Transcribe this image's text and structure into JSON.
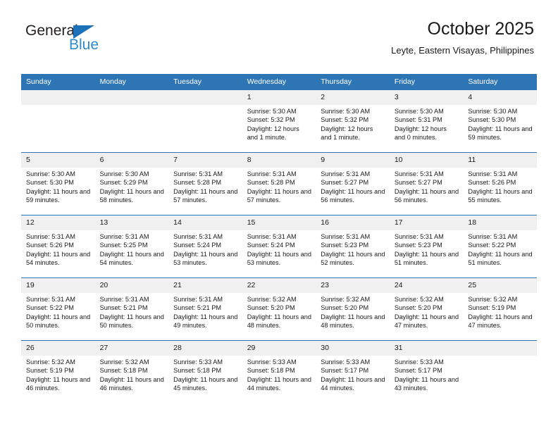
{
  "brand": {
    "name_top": "General",
    "name_bottom": "Blue",
    "flag_icon": "triangle-flag-icon",
    "colors": {
      "blue": "#1d71b8",
      "light_blue": "#2d8bce",
      "header_blue": "#2e75b6"
    }
  },
  "header": {
    "title": "October 2025",
    "subtitle": "Leyte, Eastern Visayas, Philippines"
  },
  "calendar": {
    "weekday_headers": [
      "Sunday",
      "Monday",
      "Tuesday",
      "Wednesday",
      "Thursday",
      "Friday",
      "Saturday"
    ],
    "weeks": [
      [
        {
          "day": "",
          "empty": true
        },
        {
          "day": "",
          "empty": true
        },
        {
          "day": "",
          "empty": true
        },
        {
          "day": "1",
          "sunrise": "Sunrise: 5:30 AM",
          "sunset": "Sunset: 5:32 PM",
          "daylight": "Daylight: 12 hours and 1 minute."
        },
        {
          "day": "2",
          "sunrise": "Sunrise: 5:30 AM",
          "sunset": "Sunset: 5:32 PM",
          "daylight": "Daylight: 12 hours and 1 minute."
        },
        {
          "day": "3",
          "sunrise": "Sunrise: 5:30 AM",
          "sunset": "Sunset: 5:31 PM",
          "daylight": "Daylight: 12 hours and 0 minutes."
        },
        {
          "day": "4",
          "sunrise": "Sunrise: 5:30 AM",
          "sunset": "Sunset: 5:30 PM",
          "daylight": "Daylight: 11 hours and 59 minutes."
        }
      ],
      [
        {
          "day": "5",
          "sunrise": "Sunrise: 5:30 AM",
          "sunset": "Sunset: 5:30 PM",
          "daylight": "Daylight: 11 hours and 59 minutes."
        },
        {
          "day": "6",
          "sunrise": "Sunrise: 5:30 AM",
          "sunset": "Sunset: 5:29 PM",
          "daylight": "Daylight: 11 hours and 58 minutes."
        },
        {
          "day": "7",
          "sunrise": "Sunrise: 5:31 AM",
          "sunset": "Sunset: 5:28 PM",
          "daylight": "Daylight: 11 hours and 57 minutes."
        },
        {
          "day": "8",
          "sunrise": "Sunrise: 5:31 AM",
          "sunset": "Sunset: 5:28 PM",
          "daylight": "Daylight: 11 hours and 57 minutes."
        },
        {
          "day": "9",
          "sunrise": "Sunrise: 5:31 AM",
          "sunset": "Sunset: 5:27 PM",
          "daylight": "Daylight: 11 hours and 56 minutes."
        },
        {
          "day": "10",
          "sunrise": "Sunrise: 5:31 AM",
          "sunset": "Sunset: 5:27 PM",
          "daylight": "Daylight: 11 hours and 56 minutes."
        },
        {
          "day": "11",
          "sunrise": "Sunrise: 5:31 AM",
          "sunset": "Sunset: 5:26 PM",
          "daylight": "Daylight: 11 hours and 55 minutes."
        }
      ],
      [
        {
          "day": "12",
          "sunrise": "Sunrise: 5:31 AM",
          "sunset": "Sunset: 5:26 PM",
          "daylight": "Daylight: 11 hours and 54 minutes."
        },
        {
          "day": "13",
          "sunrise": "Sunrise: 5:31 AM",
          "sunset": "Sunset: 5:25 PM",
          "daylight": "Daylight: 11 hours and 54 minutes."
        },
        {
          "day": "14",
          "sunrise": "Sunrise: 5:31 AM",
          "sunset": "Sunset: 5:24 PM",
          "daylight": "Daylight: 11 hours and 53 minutes."
        },
        {
          "day": "15",
          "sunrise": "Sunrise: 5:31 AM",
          "sunset": "Sunset: 5:24 PM",
          "daylight": "Daylight: 11 hours and 53 minutes."
        },
        {
          "day": "16",
          "sunrise": "Sunrise: 5:31 AM",
          "sunset": "Sunset: 5:23 PM",
          "daylight": "Daylight: 11 hours and 52 minutes."
        },
        {
          "day": "17",
          "sunrise": "Sunrise: 5:31 AM",
          "sunset": "Sunset: 5:23 PM",
          "daylight": "Daylight: 11 hours and 51 minutes."
        },
        {
          "day": "18",
          "sunrise": "Sunrise: 5:31 AM",
          "sunset": "Sunset: 5:22 PM",
          "daylight": "Daylight: 11 hours and 51 minutes."
        }
      ],
      [
        {
          "day": "19",
          "sunrise": "Sunrise: 5:31 AM",
          "sunset": "Sunset: 5:22 PM",
          "daylight": "Daylight: 11 hours and 50 minutes."
        },
        {
          "day": "20",
          "sunrise": "Sunrise: 5:31 AM",
          "sunset": "Sunset: 5:21 PM",
          "daylight": "Daylight: 11 hours and 50 minutes."
        },
        {
          "day": "21",
          "sunrise": "Sunrise: 5:31 AM",
          "sunset": "Sunset: 5:21 PM",
          "daylight": "Daylight: 11 hours and 49 minutes."
        },
        {
          "day": "22",
          "sunrise": "Sunrise: 5:32 AM",
          "sunset": "Sunset: 5:20 PM",
          "daylight": "Daylight: 11 hours and 48 minutes."
        },
        {
          "day": "23",
          "sunrise": "Sunrise: 5:32 AM",
          "sunset": "Sunset: 5:20 PM",
          "daylight": "Daylight: 11 hours and 48 minutes."
        },
        {
          "day": "24",
          "sunrise": "Sunrise: 5:32 AM",
          "sunset": "Sunset: 5:20 PM",
          "daylight": "Daylight: 11 hours and 47 minutes."
        },
        {
          "day": "25",
          "sunrise": "Sunrise: 5:32 AM",
          "sunset": "Sunset: 5:19 PM",
          "daylight": "Daylight: 11 hours and 47 minutes."
        }
      ],
      [
        {
          "day": "26",
          "sunrise": "Sunrise: 5:32 AM",
          "sunset": "Sunset: 5:19 PM",
          "daylight": "Daylight: 11 hours and 46 minutes."
        },
        {
          "day": "27",
          "sunrise": "Sunrise: 5:32 AM",
          "sunset": "Sunset: 5:18 PM",
          "daylight": "Daylight: 11 hours and 46 minutes."
        },
        {
          "day": "28",
          "sunrise": "Sunrise: 5:33 AM",
          "sunset": "Sunset: 5:18 PM",
          "daylight": "Daylight: 11 hours and 45 minutes."
        },
        {
          "day": "29",
          "sunrise": "Sunrise: 5:33 AM",
          "sunset": "Sunset: 5:18 PM",
          "daylight": "Daylight: 11 hours and 44 minutes."
        },
        {
          "day": "30",
          "sunrise": "Sunrise: 5:33 AM",
          "sunset": "Sunset: 5:17 PM",
          "daylight": "Daylight: 11 hours and 44 minutes."
        },
        {
          "day": "31",
          "sunrise": "Sunrise: 5:33 AM",
          "sunset": "Sunset: 5:17 PM",
          "daylight": "Daylight: 11 hours and 43 minutes."
        },
        {
          "day": "",
          "empty": true
        }
      ]
    ]
  }
}
